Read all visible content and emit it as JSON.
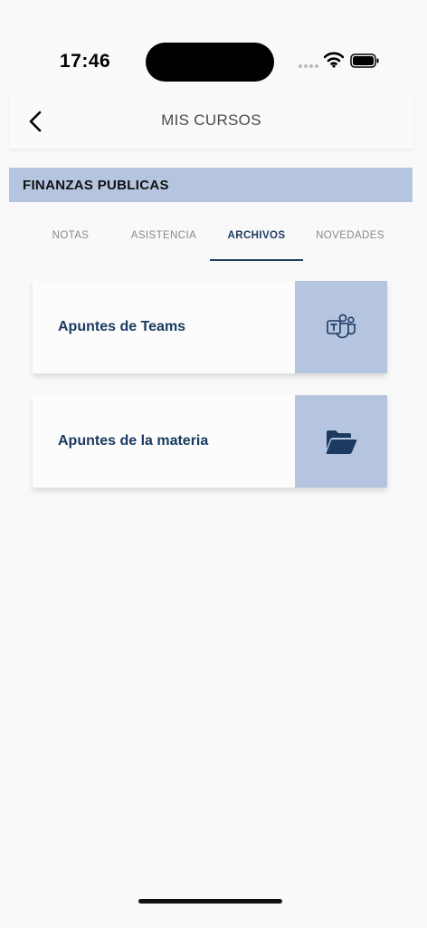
{
  "status_bar": {
    "time": "17:46",
    "icons": [
      "signal-icon",
      "wifi-icon",
      "battery-icon"
    ]
  },
  "header": {
    "title": "MIS CURSOS",
    "back_icon": "chevron-left-icon"
  },
  "course": {
    "name": "FINANZAS PUBLICAS"
  },
  "tabs": [
    {
      "label": "NOTAS",
      "active": false
    },
    {
      "label": "ASISTENCIA",
      "active": false
    },
    {
      "label": "ARCHIVOS",
      "active": true
    },
    {
      "label": "NOVEDADES",
      "active": false
    }
  ],
  "files": [
    {
      "label": "Apuntes de Teams",
      "icon": "teams-icon"
    },
    {
      "label": "Apuntes de la materia",
      "icon": "folder-open-icon"
    }
  ],
  "colors": {
    "accent": "#b5c5e0",
    "primary_text": "#1a3a60",
    "background": "#f9f9f9"
  }
}
